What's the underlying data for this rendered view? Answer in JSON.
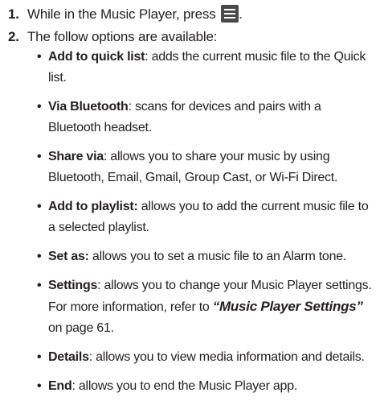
{
  "steps": [
    {
      "num": "1.",
      "text": "While in the Music Player, press",
      "icon": "menu-icon",
      "after_icon": "."
    },
    {
      "num": "2.",
      "text": "The follow options are available:"
    }
  ],
  "options": [
    {
      "term": "Add to quick list",
      "desc": ": adds the current music file to the Quick list."
    },
    {
      "term": "Via Bluetooth",
      "desc": ": scans for devices and pairs with a Bluetooth headset."
    },
    {
      "term": "Share via",
      "desc": ": allows you to share your music by using Bluetooth, Email, Gmail, Group Cast, or Wi-Fi Direct."
    },
    {
      "term": "Add to playlist:",
      "desc": " allows you to add the current music file to a selected playlist."
    },
    {
      "term": "Set as:",
      "desc": " allows you to set a music file to an Alarm tone."
    },
    {
      "term": "Settings",
      "desc": ": allows you to change your Music Player settings. For more information, refer to ",
      "ref": "“Music Player Settings”",
      "desc_after": " on page 61."
    },
    {
      "term": "Details",
      "desc": ": allows you to view media information and details."
    },
    {
      "term": "End",
      "desc": ": allows you to end the Music Player app."
    }
  ],
  "bullet_glyph": "•"
}
